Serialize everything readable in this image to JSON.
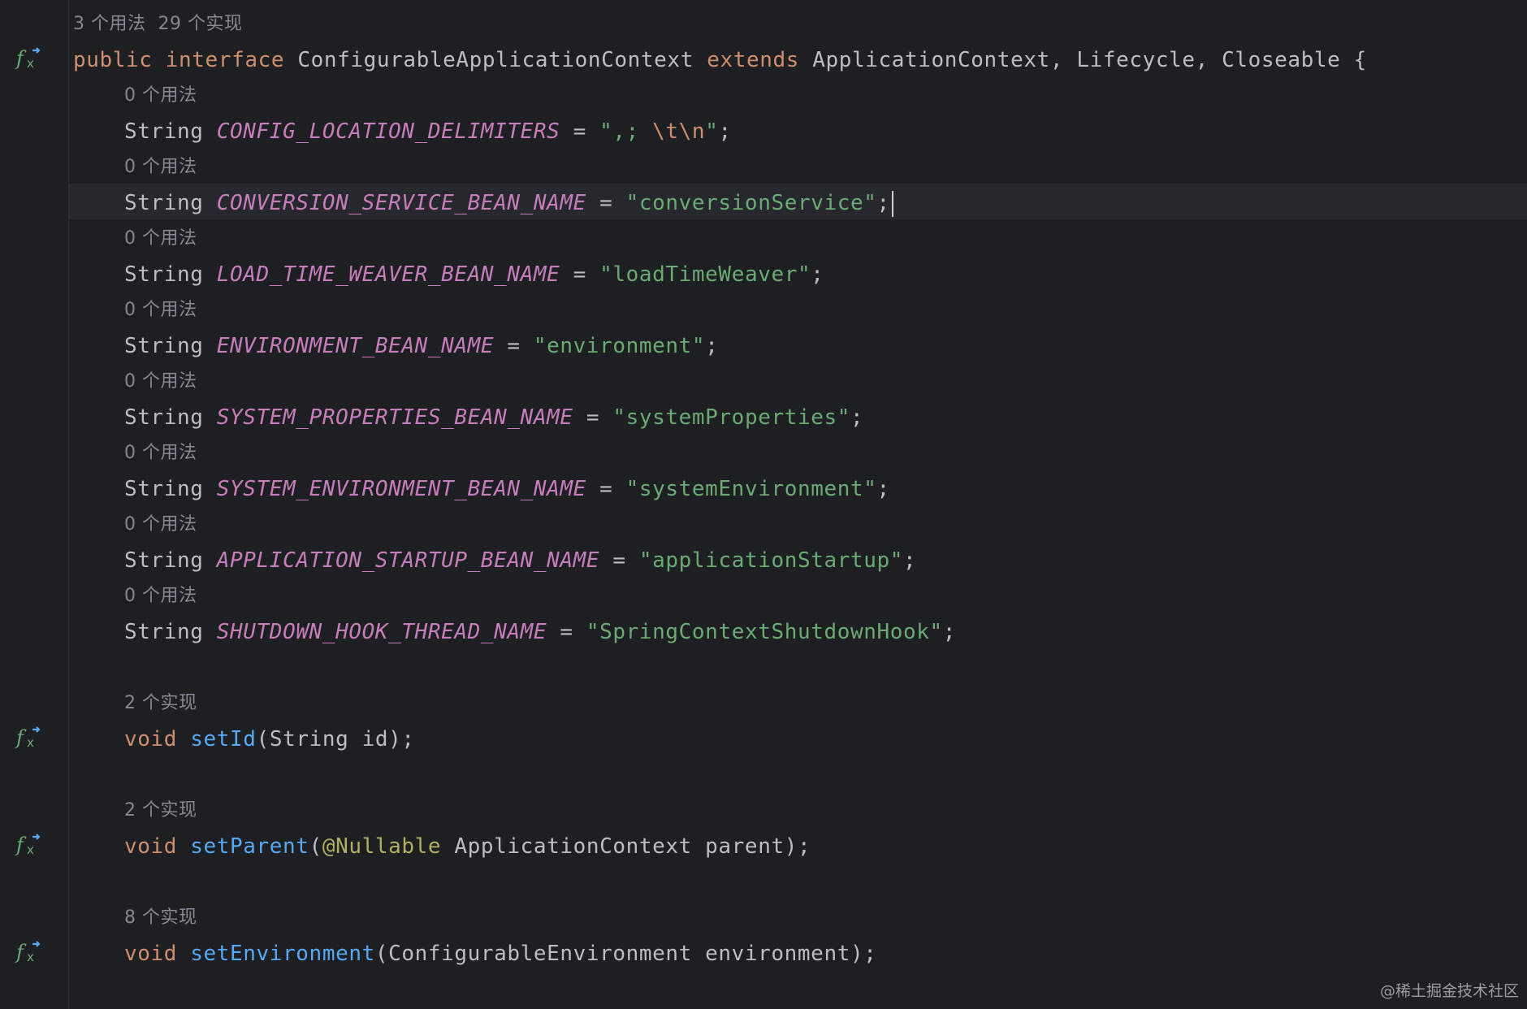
{
  "editor": {
    "class_hint": {
      "usages": "3 个用法",
      "impls": "29 个实现"
    },
    "declaration": {
      "public": "public",
      "interface": "interface",
      "name": "ConfigurableApplicationContext",
      "extends": "extends",
      "parents": "ApplicationContext, Lifecycle, Closeable {"
    },
    "fields": [
      {
        "hint": "0 个用法",
        "type": "String",
        "name": "CONFIG_LOCATION_DELIMITERS",
        "eq": " = ",
        "value_a": "\",; ",
        "escape": "\\t\\n",
        "value_b": "\"",
        "end": ";"
      },
      {
        "hint": "0 个用法",
        "type": "String",
        "name": "CONVERSION_SERVICE_BEAN_NAME",
        "eq": " = ",
        "value": "\"conversionService\"",
        "end": ";"
      },
      {
        "hint": "0 个用法",
        "type": "String",
        "name": "LOAD_TIME_WEAVER_BEAN_NAME",
        "eq": " = ",
        "value": "\"loadTimeWeaver\"",
        "end": ";"
      },
      {
        "hint": "0 个用法",
        "type": "String",
        "name": "ENVIRONMENT_BEAN_NAME",
        "eq": " = ",
        "value": "\"environment\"",
        "end": ";"
      },
      {
        "hint": "0 个用法",
        "type": "String",
        "name": "SYSTEM_PROPERTIES_BEAN_NAME",
        "eq": " = ",
        "value": "\"systemProperties\"",
        "end": ";"
      },
      {
        "hint": "0 个用法",
        "type": "String",
        "name": "SYSTEM_ENVIRONMENT_BEAN_NAME",
        "eq": " = ",
        "value": "\"systemEnvironment\"",
        "end": ";"
      },
      {
        "hint": "0 个用法",
        "type": "String",
        "name": "APPLICATION_STARTUP_BEAN_NAME",
        "eq": " = ",
        "value": "\"applicationStartup\"",
        "end": ";"
      },
      {
        "hint": "0 个用法",
        "type": "String",
        "name": "SHUTDOWN_HOOK_THREAD_NAME",
        "eq": " = ",
        "value": "\"SpringContextShutdownHook\"",
        "end": ";"
      }
    ],
    "methods": [
      {
        "hint": "2 个实现",
        "ret": "void",
        "name": "setId",
        "args": "(String id);"
      },
      {
        "hint": "2 个实现",
        "ret": "void",
        "name": "setParent",
        "open": "(",
        "anno": "@Nullable",
        "args": " ApplicationContext parent);"
      },
      {
        "hint": "8 个实现",
        "ret": "void",
        "name": "setEnvironment",
        "args": "(ConfigurableEnvironment environment);"
      }
    ],
    "gutter_icon": "implemented-method-icon"
  },
  "watermark": "@稀土掘金技术社区",
  "colors": {
    "background": "#1e1f22",
    "keyword": "#cf8e6d",
    "field": "#c77dbb",
    "string": "#6aab73",
    "method": "#56a8f5",
    "annotation": "#b3ae60",
    "text": "#bcbec4",
    "hint": "#868993"
  }
}
